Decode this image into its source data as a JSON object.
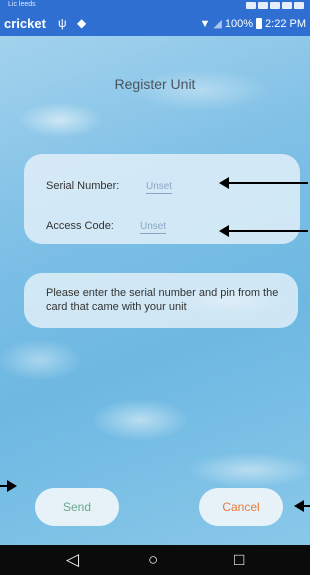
{
  "status_bar": {
    "carrier_small": "Lic leeds",
    "carrier": "cricket",
    "battery": "100%",
    "time": "2:22 PM"
  },
  "page": {
    "title": "Register Unit"
  },
  "form": {
    "serial_label": "Serial Number:",
    "serial_value": "Unset",
    "access_label": "Access Code:",
    "access_value": "Unset"
  },
  "info": {
    "text": "Please enter the serial number and pin from the card that came with your unit"
  },
  "buttons": {
    "send": "Send",
    "cancel": "Cancel"
  },
  "nav": {
    "back_icon": "◁",
    "home_icon": "○",
    "recents_icon": "□"
  },
  "colors": {
    "status_bar": "#2f6fd1",
    "send_text": "#6aa88a",
    "cancel_text": "#e57a3a",
    "input_text": "#8aa6c7"
  }
}
